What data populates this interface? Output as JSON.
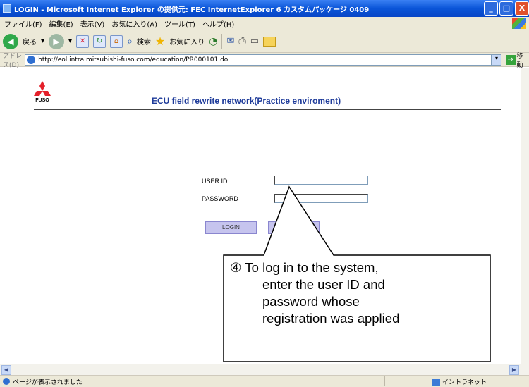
{
  "window": {
    "title": "LOGIN - Microsoft Internet Explorer の提供元: FEC InternetExplorer 6 カスタムパッケージ 0409",
    "btn_minimize": "_",
    "btn_maximize": "□",
    "btn_close": "X"
  },
  "menu": {
    "file": "ファイル(F)",
    "edit": "編集(E)",
    "view": "表示(V)",
    "favorites": "お気に入り(A)",
    "tools": "ツール(T)",
    "help": "ヘルプ(H)"
  },
  "toolbar": {
    "back_label": "戻る",
    "search_label": "検索",
    "favorites_label": "お気に入り"
  },
  "address": {
    "label": "アドレス(D)",
    "url": "http://eol.intra.mitsubishi-fuso.com/education/PR000101.do",
    "go_label": "移動"
  },
  "page": {
    "logo_text": "FUSO",
    "title": "ECU field rewrite network(Practice enviroment)",
    "user_id_label": "USER ID",
    "password_label": "PASSWORD",
    "colon": ":",
    "user_id_value": "",
    "password_value": "",
    "login_button": "LOGIN",
    "clear_button": ""
  },
  "callout": {
    "number": "④",
    "line1": "To log in to the system,",
    "line2": "enter the user ID and",
    "line3": "password whose",
    "line4": "registration was applied"
  },
  "status": {
    "message": "ページが表示されました",
    "zone": "イントラネット"
  },
  "colors": {
    "title_blue": "#1e3b9a",
    "button_lavender": "#c6c4ee",
    "fuso_red": "#e4202a"
  }
}
